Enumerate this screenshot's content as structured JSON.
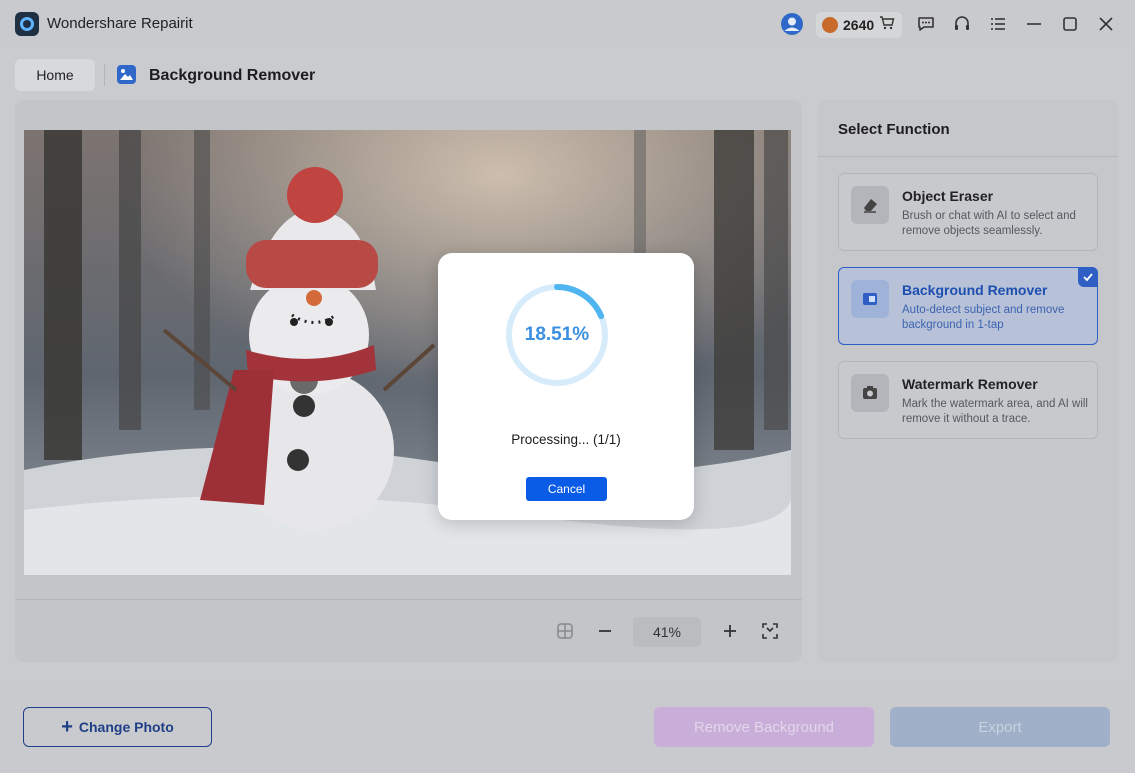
{
  "app": {
    "title": "Wondershare Repairit",
    "credits": "2640"
  },
  "breadcrumb": {
    "home": "Home",
    "current": "Background Remover"
  },
  "canvas": {
    "zoom": "41%"
  },
  "right_panel": {
    "title": "Select Function",
    "functions": [
      {
        "name": "Object Eraser",
        "desc": "Brush or chat with AI to select and remove objects seamlessly.",
        "icon": "eraser-icon",
        "selected": false
      },
      {
        "name": "Background Remover",
        "desc": "Auto-detect subject and remove background in 1-tap",
        "icon": "background-remover-icon",
        "selected": true
      },
      {
        "name": "Watermark Remover",
        "desc": "Mark the watermark area, and AI will remove it without a trace.",
        "icon": "watermark-remover-icon",
        "selected": false
      }
    ]
  },
  "bottom": {
    "change_photo": "Change Photo",
    "remove_background": "Remove Background",
    "export": "Export"
  },
  "modal": {
    "progress": "18.51%",
    "progress_value": 0.1851,
    "status": "Processing... (1/1)",
    "cancel": "Cancel"
  },
  "colors": {
    "accent": "#0a5be6",
    "progress": "#3a8fe0"
  }
}
